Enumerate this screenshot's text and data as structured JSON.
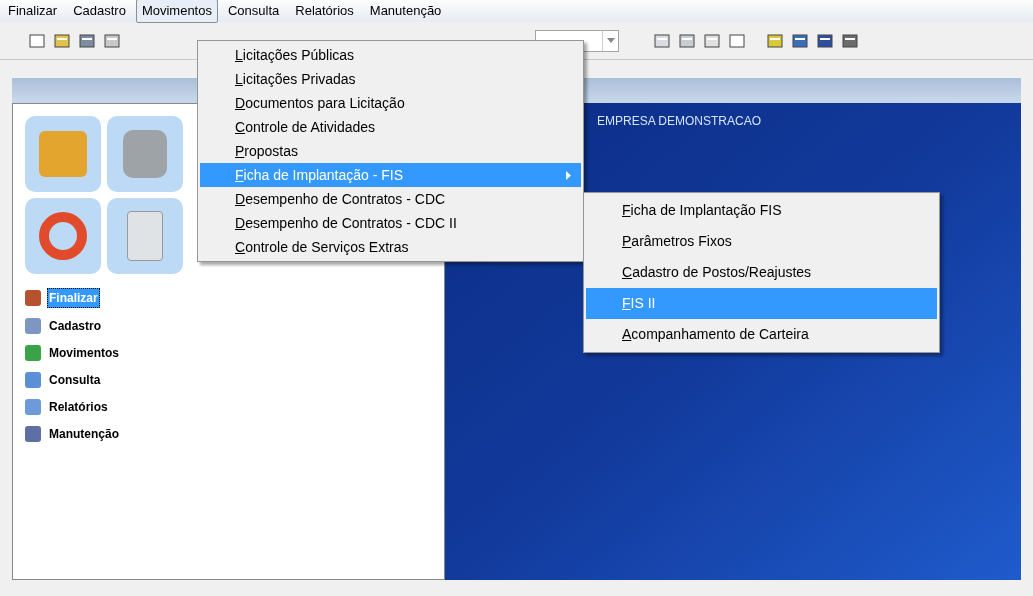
{
  "menubar": [
    {
      "label": "Finalizar",
      "selected": false
    },
    {
      "label": "Cadastro",
      "selected": false
    },
    {
      "label": "Movimentos",
      "selected": true
    },
    {
      "label": "Consulta",
      "selected": false
    },
    {
      "label": "Relatórios",
      "selected": false
    },
    {
      "label": "Manutenção",
      "selected": false
    }
  ],
  "navigation": [
    {
      "label": "Finalizar",
      "selected": true
    },
    {
      "label": "Cadastro",
      "selected": false
    },
    {
      "label": "Movimentos",
      "selected": false
    },
    {
      "label": "Consulta",
      "selected": false
    },
    {
      "label": "Relatórios",
      "selected": false
    },
    {
      "label": "Manutenção",
      "selected": false
    }
  ],
  "company": "EMPRESA DEMONSTRACAO",
  "menu": [
    {
      "label": "Licitações Públicas",
      "selected": false,
      "submenu": false
    },
    {
      "label": "Licitações Privadas",
      "selected": false,
      "submenu": false
    },
    {
      "label": "Documentos para Licitação",
      "selected": false,
      "submenu": false
    },
    {
      "label": "Controle de Atividades",
      "selected": false,
      "submenu": false
    },
    {
      "label": "Propostas",
      "selected": false,
      "submenu": false
    },
    {
      "label": "Ficha de Implantação - FIS",
      "selected": true,
      "submenu": true
    },
    {
      "label": "Desempenho de Contratos - CDC",
      "selected": false,
      "submenu": false
    },
    {
      "label": "Desempenho de Contratos - CDC II",
      "selected": false,
      "submenu": false
    },
    {
      "label": "Controle de Serviços Extras",
      "selected": false,
      "submenu": false
    }
  ],
  "submenu": [
    {
      "label": "Ficha de Implantação FIS",
      "selected": false
    },
    {
      "label": "Parâmetros Fixos",
      "selected": false
    },
    {
      "label": "Cadastro de Postos/Reajustes",
      "selected": false
    },
    {
      "label": "FIS II",
      "selected": true
    },
    {
      "label": "Acompanhamento de Carteira",
      "selected": false
    }
  ]
}
